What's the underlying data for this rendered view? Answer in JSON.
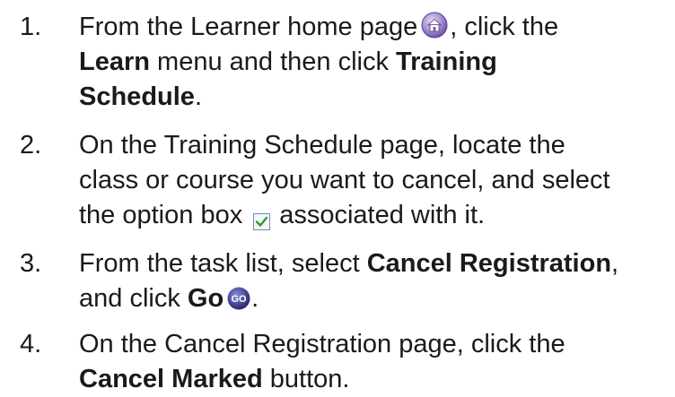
{
  "steps": [
    {
      "number": "1.",
      "lines": [
        {
          "a": "From the Learner home page",
          "b": ", click the"
        },
        {
          "a": "Learn",
          "b": " menu and then click ",
          "c": "Training"
        },
        {
          "a": "Schedule",
          "b": "."
        }
      ]
    },
    {
      "number": "2.",
      "lines": [
        {
          "a": "On the Training Schedule page, locate the"
        },
        {
          "a": "class or course you want to cancel, and select"
        },
        {
          "a": "the option box",
          "b": "associated with it."
        }
      ]
    },
    {
      "number": "3.",
      "lines": [
        {
          "a": "From the task list, select ",
          "b": "Cancel Registration",
          "c": ","
        },
        {
          "a": "and click ",
          "b": "Go",
          "c": "."
        }
      ]
    },
    {
      "number": "4.",
      "lines": [
        {
          "a": "On the Cancel Registration page, click the"
        },
        {
          "a": "Cancel Marked",
          "b": " button."
        }
      ]
    }
  ],
  "icons": {
    "home": "home-icon",
    "checkbox": "checkbox-checked-icon",
    "go": "go-button-icon",
    "go_text": "GO"
  },
  "colors": {
    "text": "#1a1a1a",
    "home_icon": "#8c6fbf",
    "checkbox_border": "#6f8fb0",
    "checkbox_mark": "#2f9a2f",
    "go_icon": "#3d3d8f"
  }
}
